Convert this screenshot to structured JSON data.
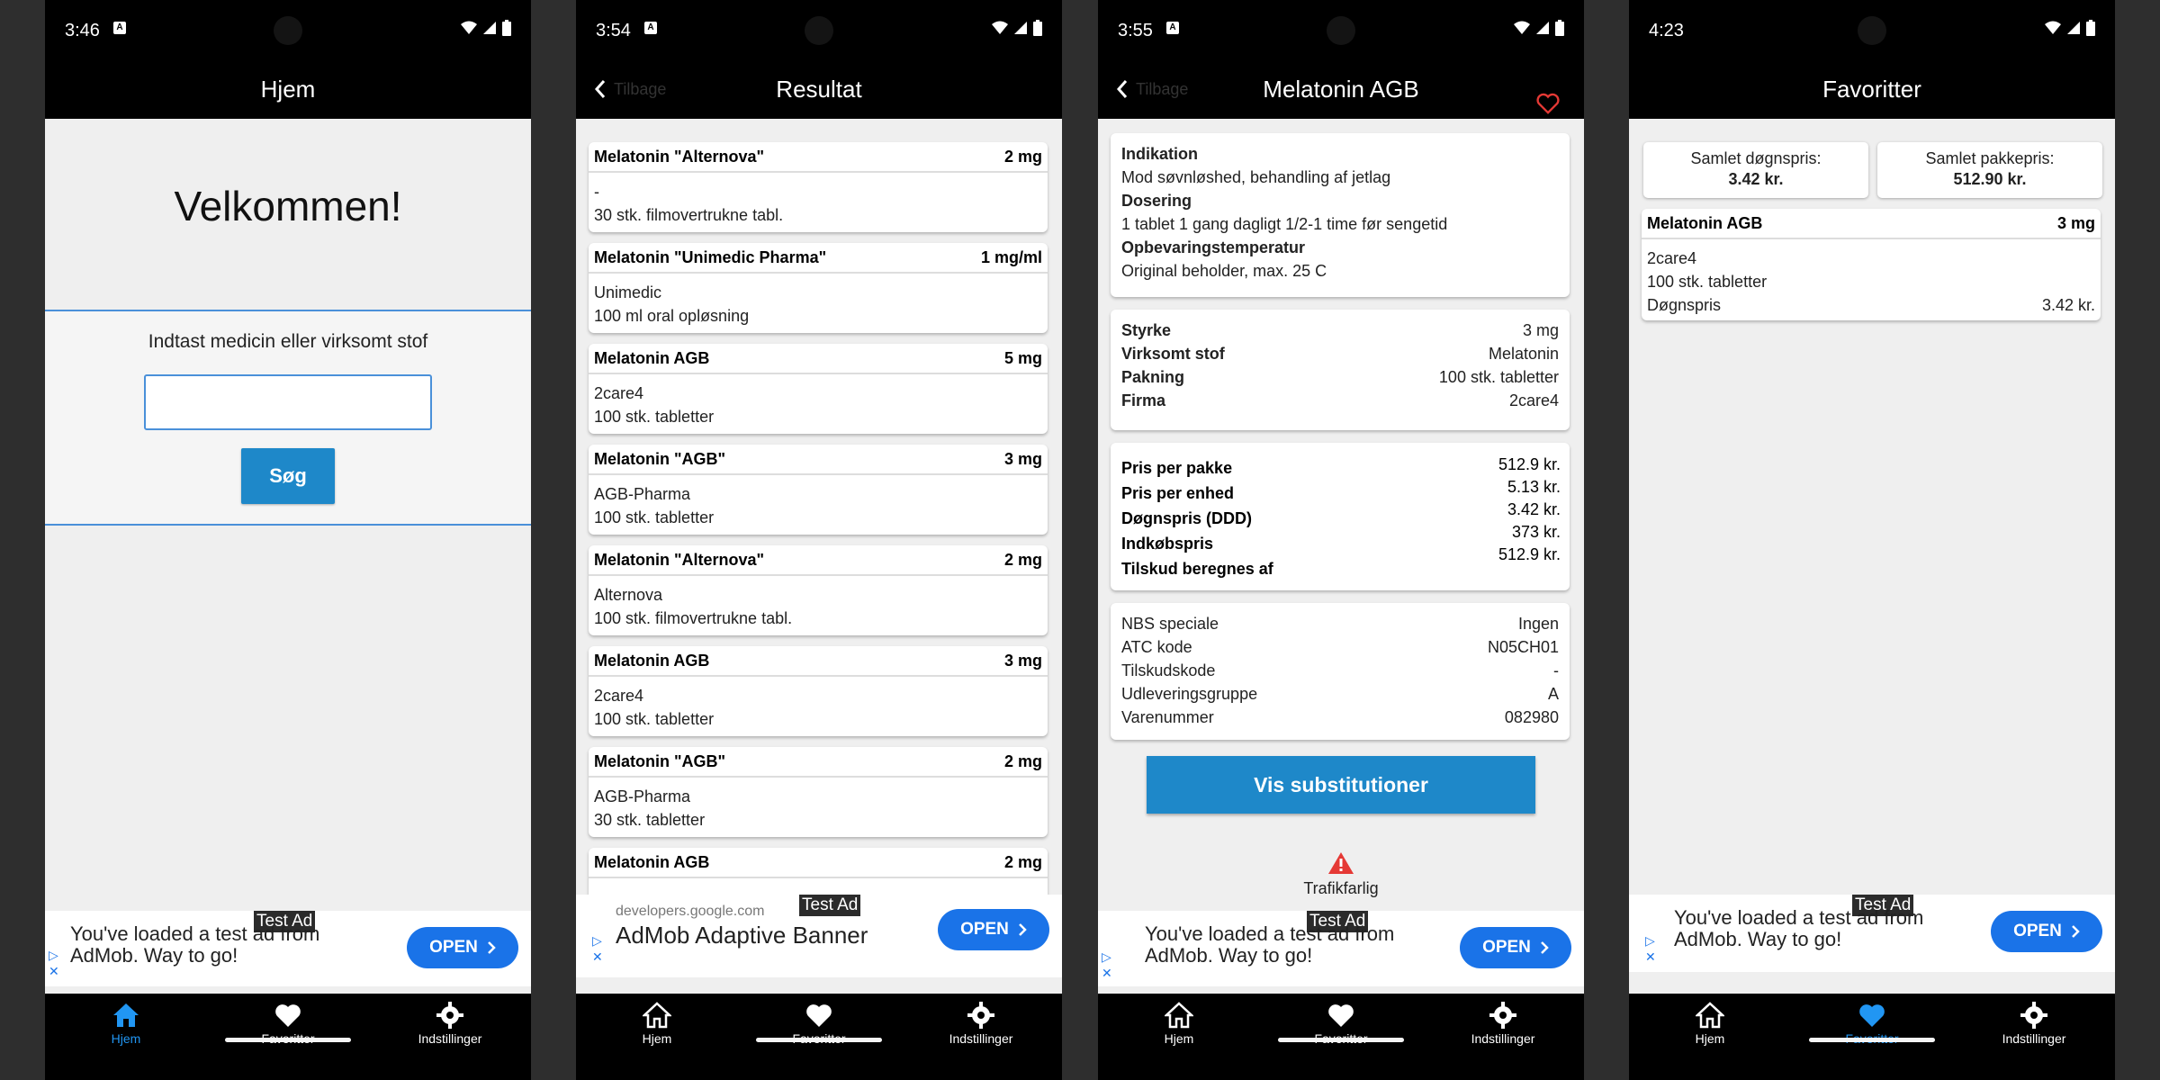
{
  "statusbar": [
    {
      "time": "3:46"
    },
    {
      "time": "3:54"
    },
    {
      "time": "3:55"
    },
    {
      "time": "4:23"
    }
  ],
  "nav": {
    "home": "Hjem",
    "favorites": "Favoritter",
    "settings": "Indstillinger"
  },
  "colors": {
    "accent": "#2196f3",
    "button_blue": "#1e88c9",
    "heart": "#e53935"
  },
  "ad": {
    "test_label": "Test Ad",
    "message_line1": "You've loaded a test ad from",
    "message_line2": "AdMob. Way to go!",
    "open": "OPEN",
    "url": "developers.google.com",
    "banner_title": "AdMob Adaptive Banner"
  },
  "screen1": {
    "title": "Hjem",
    "welcome": "Velkommen!",
    "prompt": "Indtast medicin eller virksomt stof",
    "search_value": "",
    "search_button": "Søg"
  },
  "screen2": {
    "title": "Resultat",
    "back": "Tilbage",
    "results": [
      {
        "name": "Melatonin \"Alternova\"",
        "strength": "2 mg",
        "line1": "-",
        "line2": "30 stk. filmovertrukne tabl."
      },
      {
        "name": "Melatonin \"Unimedic Pharma\"",
        "strength": "1 mg/ml",
        "line1": "Unimedic",
        "line2": "100 ml oral opløsning"
      },
      {
        "name": "Melatonin AGB",
        "strength": "5 mg",
        "line1": "2care4",
        "line2": "100 stk. tabletter"
      },
      {
        "name": "Melatonin \"AGB\"",
        "strength": "3 mg",
        "line1": "AGB-Pharma",
        "line2": "100 stk. tabletter"
      },
      {
        "name": "Melatonin \"Alternova\"",
        "strength": "2 mg",
        "line1": "Alternova",
        "line2": "100 stk. filmovertrukne tabl."
      },
      {
        "name": "Melatonin AGB",
        "strength": "3 mg",
        "line1": "2care4",
        "line2": "100 stk. tabletter"
      },
      {
        "name": "Melatonin \"AGB\"",
        "strength": "2 mg",
        "line1": "AGB-Pharma",
        "line2": "30 stk. tabletter"
      },
      {
        "name": "Melatonin AGB",
        "strength": "2 mg",
        "line1": "",
        "line2": ""
      }
    ]
  },
  "screen3": {
    "title": "Melatonin AGB",
    "back": "Tilbage",
    "indication_label": "Indikation",
    "indication": "Mod søvnløshed, behandling af jetlag",
    "dosage_label": "Dosering",
    "dosage": "1 tablet 1 gang dagligt 1/2-1 time før sengetid",
    "storage_label": "Opbevaringstemperatur",
    "storage": "Original beholder, max. 25 C",
    "details": [
      {
        "label": "Styrke",
        "value": "3 mg"
      },
      {
        "label": "Virksomt stof",
        "value": "Melatonin"
      },
      {
        "label": "Pakning",
        "value": "100 stk. tabletter"
      },
      {
        "label": "Firma",
        "value": "2care4"
      }
    ],
    "prices_labels": [
      "Pris per pakke",
      "Pris per enhed",
      "Døgnspris (DDD)",
      "Indkøbspris",
      "Tilskud beregnes af"
    ],
    "prices_values": [
      "512.9 kr.",
      "5.13 kr.",
      "3.42 kr.",
      "373 kr.",
      "512.9 kr."
    ],
    "codes": [
      {
        "label": "NBS speciale",
        "value": "Ingen"
      },
      {
        "label": "ATC kode",
        "value": "N05CH01"
      },
      {
        "label": "Tilskudskode",
        "value": "-"
      },
      {
        "label": "Udleveringsgruppe",
        "value": "A"
      },
      {
        "label": "Varenummer",
        "value": "082980"
      }
    ],
    "substitutions_button": "Vis substitutioner",
    "warning": "Trafikfarlig"
  },
  "screen4": {
    "title": "Favoritter",
    "daily_total_label": "Samlet døgnspris:",
    "daily_total": "3.42 kr.",
    "package_total_label": "Samlet pakkepris:",
    "package_total": "512.90 kr.",
    "favorite": {
      "name": "Melatonin AGB",
      "strength": "3 mg",
      "line1": "2care4",
      "line2": "100 stk. tabletter",
      "price_label": "Døgnspris",
      "price": "3.42 kr."
    }
  }
}
